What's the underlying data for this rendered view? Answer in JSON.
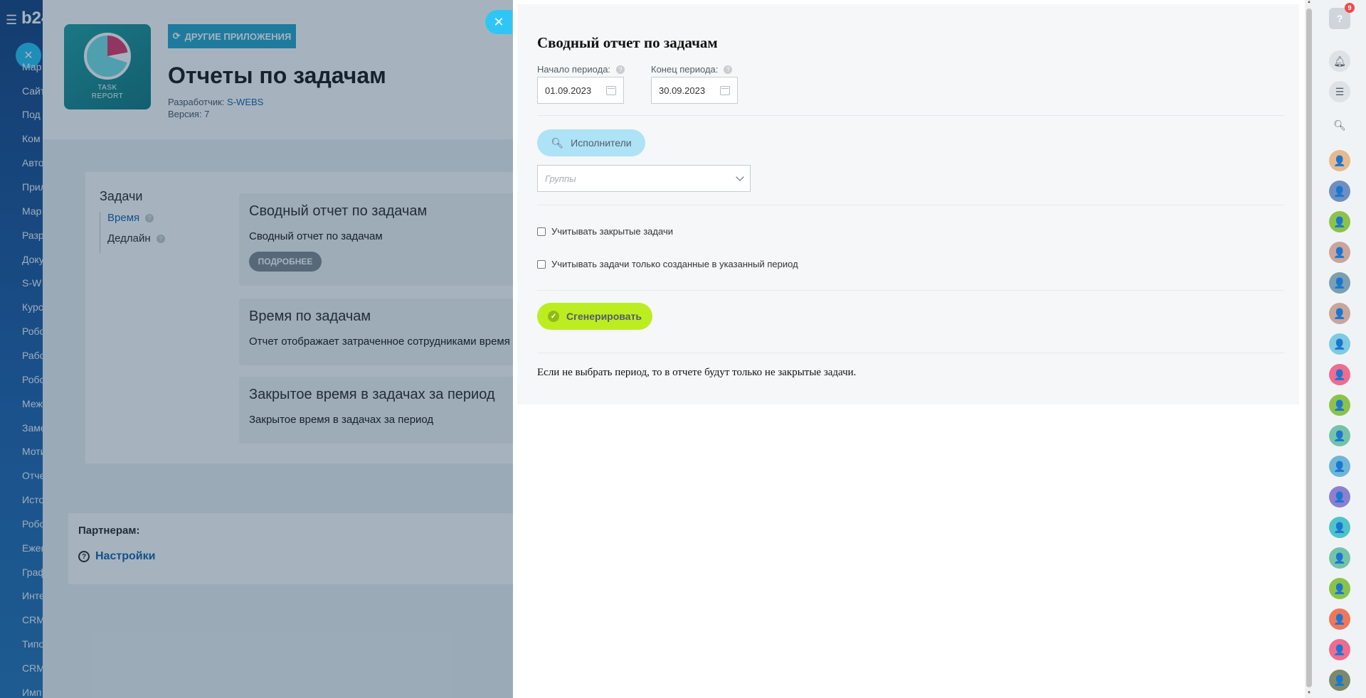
{
  "left_sidebar": {
    "logo": "b24",
    "items": [
      "Мар",
      "Сайт",
      "Под",
      "Ком",
      "Авто",
      "Прил",
      "Мар",
      "Разр",
      "Доку",
      "S-W",
      "Курс",
      "Робо",
      "Рабо",
      "Робо",
      "Меж",
      "Заме",
      "Моти",
      "Отче",
      "Исто",
      "Робо",
      "Ежек",
      "Граф",
      "Инте",
      "CRM",
      "Типо",
      "CRM",
      "Имп"
    ]
  },
  "app": {
    "icon_text": "TASK\nREPORT",
    "other_apps": "ДРУГИЕ ПРИЛОЖЕНИЯ",
    "title": "Отчеты по задачам",
    "developer_label": "Разработчик:",
    "developer_name": "S-WEBS",
    "version": "Версия: 7",
    "tasks_title": "Задачи",
    "nav": [
      "Время",
      "Дедлайн"
    ],
    "cards": [
      {
        "title": "Сводный отчет по задачам",
        "desc": "Сводный отчет по задачам",
        "button": "ПОДРОБНЕЕ"
      },
      {
        "title": "Время по задачам",
        "desc": "Отчет отображает затраченное сотрудниками время н"
      },
      {
        "title": "Закрытое время в задачах за период",
        "desc": "Закрытое время в задачах за период"
      }
    ],
    "partners_title": "Партнерам:",
    "settings_link": "Настройки"
  },
  "slider": {
    "title": "Сводный отчет по задачам",
    "start_label": "Начало периода:",
    "start_value": "01.09.2023",
    "end_label": "Конец периода:",
    "end_value": "30.09.2023",
    "executors_button": "Исполнители",
    "groups_placeholder": "Группы",
    "checkbox_closed": "Учитывать закрытые задачи",
    "checkbox_period": "Учитывать задачи только созданные в указанный период",
    "generate_button": "Сгенерировать",
    "note": "Если не выбрать период, то в отчете будут только не закрытые задачи."
  },
  "right_bar": {
    "help_badge": "9",
    "avatar_colors": [
      "#e7b98f",
      "#6f8fc1",
      "#8bc34a",
      "#c9a59a",
      "#7a9fb0",
      "#c9a59a",
      "#7ecbe0",
      "#f06c8e",
      "#8bc34a",
      "#74c3a9",
      "#6fb5d6",
      "#8d7fcf",
      "#4fc3c9",
      "#74c3a9",
      "#8bc34a",
      "#f0785a",
      "#f06c8e",
      "#7d8a6a"
    ]
  },
  "colors": {
    "accent_blue": "#2fc6f6",
    "generate_green": "#bbed21",
    "executors_blue": "#aee2f6"
  }
}
